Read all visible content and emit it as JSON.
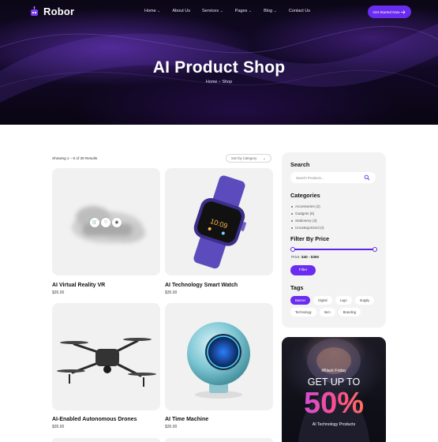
{
  "brand": {
    "name": "Robor"
  },
  "nav": {
    "items": [
      {
        "label": "Home",
        "dropdown": true
      },
      {
        "label": "About Us",
        "dropdown": false
      },
      {
        "label": "Services",
        "dropdown": true
      },
      {
        "label": "Pages",
        "dropdown": true
      },
      {
        "label": "Blog",
        "dropdown": true
      },
      {
        "label": "Contact Us",
        "dropdown": false
      }
    ],
    "cta_label": "Get Started Now"
  },
  "hero": {
    "title": "AI Product Shop",
    "breadcrumb": [
      "Home",
      "Shop"
    ],
    "breadcrumb_separator": "›"
  },
  "toolbar": {
    "results_text": "Showing 1 – 6 of 30 Results",
    "sort_value": "Sort by Category"
  },
  "products": [
    {
      "name": "AI Virtual Reality VR",
      "price": "$35.00",
      "image_icon": "vr-headset-image"
    },
    {
      "name": "AI Technology Smart Watch",
      "price": "$35.00",
      "image_icon": "smart-watch-image"
    },
    {
      "name": "AI-Enabled Autonomous Drones",
      "price": "$35.00",
      "image_icon": "drone-image"
    },
    {
      "name": "AI Time Machine",
      "price": "$35.00",
      "image_icon": "time-machine-orb-image"
    }
  ],
  "sidebar": {
    "search_heading": "Search",
    "search_placeholder": "Search Products...",
    "categories_heading": "Categories",
    "categories": [
      "Accessories (2)",
      "Gadgets (6)",
      "Stationery (3)",
      "Uncategorized (4)"
    ],
    "price_heading": "Filter By Price",
    "price_prefix": "Price:",
    "price_range": "$40 - $350",
    "filter_button": "Filter",
    "tags_heading": "Tags",
    "tags": [
      "Banner",
      "Digital",
      "Logo",
      "Supply",
      "Technology",
      "Item",
      "Branding"
    ],
    "active_tag": "Banner"
  },
  "promo": {
    "small": "#Black Friday",
    "headline": "GET UP TO",
    "percent": "50%",
    "sub": "AI Technology Products"
  },
  "colors": {
    "accent": "#6a2cf0",
    "hero_bg": "#0b0716",
    "card_bg": "#f1f1f1",
    "sidebar_bg": "#f3f3f3"
  }
}
